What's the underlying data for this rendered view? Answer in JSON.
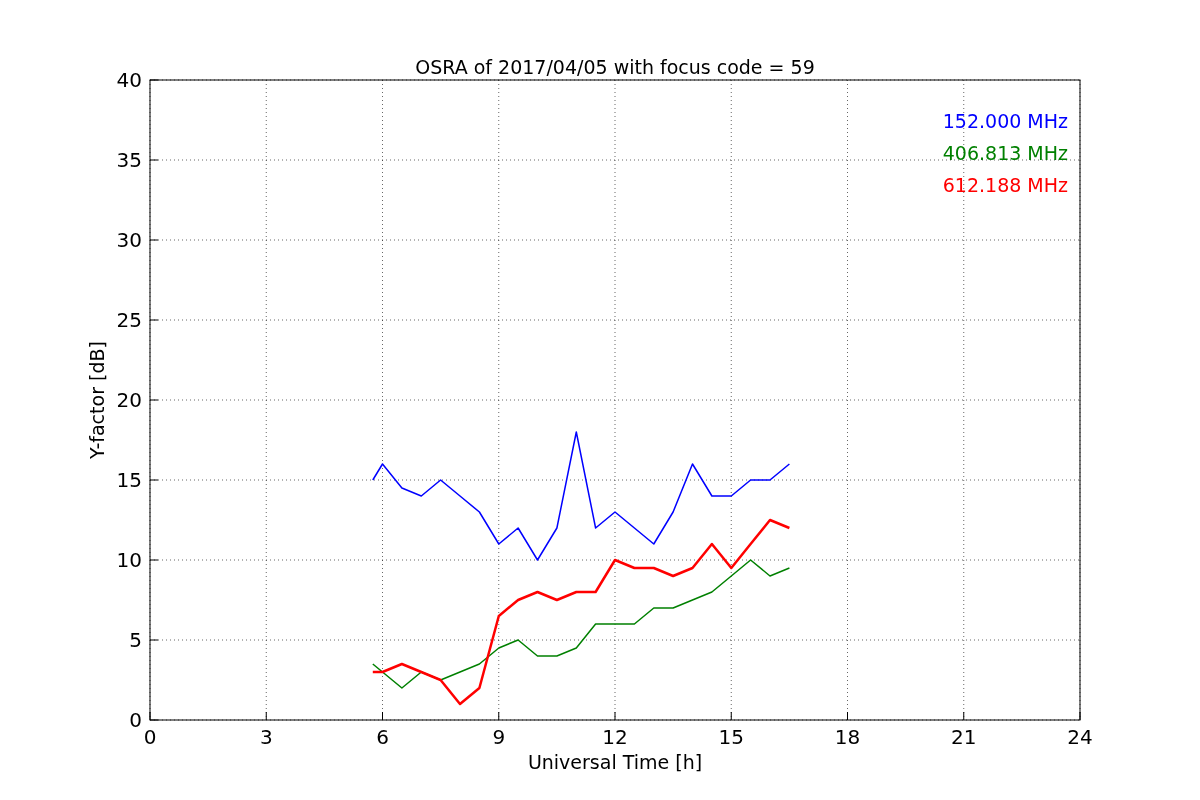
{
  "chart_data": {
    "type": "line",
    "title": "OSRA of 2017/04/05 with focus code = 59",
    "xlabel": "Universal Time [h]",
    "ylabel": "Y-factor [dB]",
    "x": [
      5.75,
      6,
      6.5,
      7,
      7.5,
      8,
      8.5,
      9,
      9.5,
      10,
      10.5,
      11,
      11.5,
      12,
      12.5,
      13,
      13.5,
      14,
      14.5,
      15,
      15.5,
      16,
      16.5
    ],
    "series": [
      {
        "name": "152.000 MHz",
        "color": "#0000ff",
        "values": [
          15,
          16,
          14.5,
          14,
          15,
          14,
          13,
          11,
          12,
          10,
          12,
          18,
          12,
          13,
          12,
          11,
          13,
          16,
          14,
          14,
          15,
          15,
          16
        ]
      },
      {
        "name": "406.813 MHz",
        "color": "#008000",
        "values": [
          3.5,
          3,
          2,
          3,
          2.5,
          3,
          3.5,
          4.5,
          5,
          4,
          4,
          4.5,
          6,
          6,
          6,
          7,
          7,
          7.5,
          8,
          9,
          10,
          9,
          9.5
        ]
      },
      {
        "name": "612.188 MHz",
        "color": "#ff0000",
        "values": [
          3,
          3,
          3.5,
          3,
          2.5,
          1,
          2,
          6.5,
          7.5,
          8,
          7.5,
          8,
          8,
          10,
          9.5,
          9.5,
          9,
          9.5,
          11,
          9.5,
          11,
          12.5,
          12
        ]
      }
    ],
    "grid": true,
    "xlim": [
      0,
      24
    ],
    "ylim": [
      0,
      40
    ],
    "xticks": [
      0,
      3,
      6,
      9,
      12,
      15,
      18,
      21,
      24
    ],
    "yticks": [
      0,
      5,
      10,
      15,
      20,
      25,
      30,
      35,
      40
    ]
  }
}
